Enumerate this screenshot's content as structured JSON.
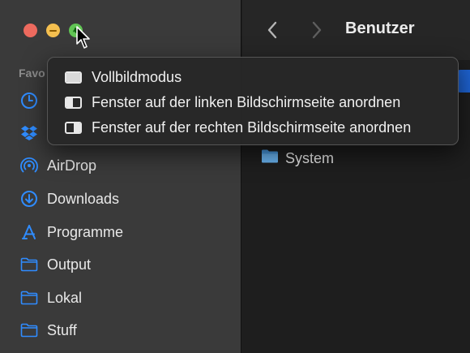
{
  "window": {
    "title": "Benutzer"
  },
  "sidebar": {
    "section_title": "Favo",
    "items": [
      {
        "label": "",
        "icon": "recents-clock-icon"
      },
      {
        "label": "",
        "icon": "dropbox-icon"
      },
      {
        "label": "AirDrop",
        "icon": "airdrop-icon"
      },
      {
        "label": "Downloads",
        "icon": "downloads-icon"
      },
      {
        "label": "Programme",
        "icon": "applications-icon"
      },
      {
        "label": "Output",
        "icon": "folder-icon"
      },
      {
        "label": "Lokal",
        "icon": "folder-icon"
      },
      {
        "label": "Stuff",
        "icon": "folder-icon"
      }
    ]
  },
  "main": {
    "files": [
      {
        "label": "System",
        "icon": "folder-icon"
      }
    ]
  },
  "menu": {
    "items": [
      {
        "label": "Vollbildmodus",
        "icon": "fullscreen-icon"
      },
      {
        "label": "Fenster auf der linken Bildschirmseite anordnen",
        "icon": "tile-left-icon"
      },
      {
        "label": "Fenster auf der rechten Bildschirmseite anordnen",
        "icon": "tile-right-icon"
      }
    ]
  },
  "colors": {
    "accent": "#2f8cff",
    "selection": "#1e63d2",
    "close": "#ed6a5e",
    "minimize": "#f4bf4f",
    "maximize": "#61c554"
  }
}
